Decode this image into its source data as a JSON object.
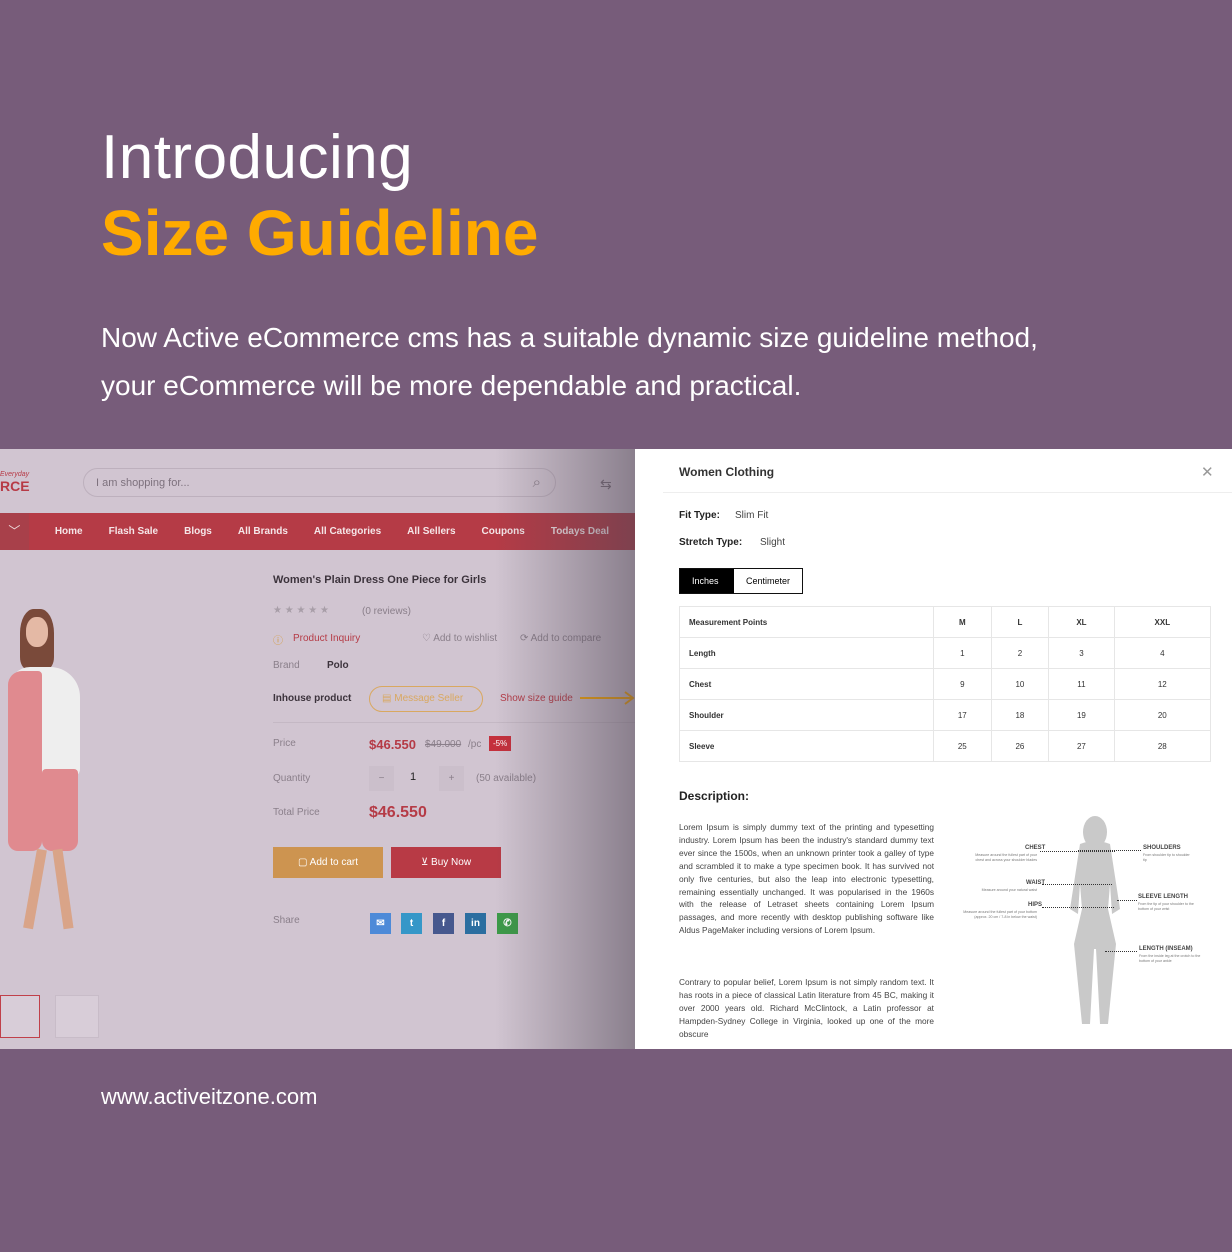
{
  "hero": {
    "intro": "Introducing",
    "headline": "Size Guideline",
    "lead": "Now Active eCommerce cms has a suitable dynamic size guideline method, your eCommerce will be more dependable and practical.",
    "website": "www.activeitzone.com",
    "accent": "#ffab00",
    "background": "#775c7a"
  },
  "shop": {
    "logo": {
      "script": "Everyday",
      "text": "RCE"
    },
    "search_placeholder": "I am shopping for...",
    "nav": [
      "Home",
      "Flash Sale",
      "Blogs",
      "All Brands",
      "All Categories",
      "All Sellers",
      "Coupons",
      "Todays Deal"
    ],
    "product": {
      "title": "Women's Plain Dress One Piece for Girls",
      "rating": 0,
      "reviews": "(0 reviews)",
      "inquiry": "Product Inquiry",
      "wishlist": "Add to wishlist",
      "compare": "Add to compare",
      "brand_label": "Brand",
      "brand": "Polo",
      "seller": "Inhouse product",
      "message_seller": "Message Seller",
      "size_guide": "Show size guide",
      "price_label": "Price",
      "price": "$46.550",
      "old_price": "$49.000",
      "unit": "/pc",
      "discount": "-5%",
      "qty_label": "Quantity",
      "qty": "1",
      "available": "(50 available)",
      "total_label": "Total Price",
      "total": "$46.550",
      "add_to_cart": "Add to cart",
      "buy_now": "Buy Now",
      "share_label": "Share"
    },
    "brand_color": "#b53b46"
  },
  "modal": {
    "title": "Women Clothing",
    "fit_label": "Fit Type:",
    "fit": "Slim Fit",
    "stretch_label": "Stretch Type:",
    "stretch": "Slight",
    "units": [
      "Inches",
      "Centimeter"
    ],
    "active_unit": "Inches",
    "table": {
      "headers": [
        "Measurement Points",
        "M",
        "L",
        "XL",
        "XXL"
      ],
      "rows": [
        [
          "Length",
          "1",
          "2",
          "3",
          "4"
        ],
        [
          "Chest",
          "9",
          "10",
          "11",
          "12"
        ],
        [
          "Shoulder",
          "17",
          "18",
          "19",
          "20"
        ],
        [
          "Sleeve",
          "25",
          "26",
          "27",
          "28"
        ]
      ]
    },
    "description_title": "Description:",
    "description": [
      "Lorem Ipsum is simply dummy text of the printing and typesetting industry. Lorem Ipsum has been the industry's standard dummy text ever since the 1500s, when an unknown printer took a galley of type and scrambled it to make a type specimen book. It has survived not only five centuries, but also the leap into electronic typesetting, remaining essentially unchanged. It was popularised in the 1960s with the release of Letraset sheets containing Lorem Ipsum passages, and more recently with desktop publishing software like Aldus PageMaker including versions of Lorem Ipsum.",
      "Contrary to popular belief, Lorem Ipsum is not simply random text. It has roots in a piece of classical Latin literature from 45 BC, making it over 2000 years old. Richard McClintock, a Latin professor at Hampden-Sydney College in Virginia, looked up one of the more obscure"
    ],
    "diagram": {
      "chest": {
        "label": "CHEST",
        "sub": "Measure around the fullest part of your chest and across your shoulder blades"
      },
      "waist": {
        "label": "WAIST",
        "sub": "Measure around your natural waist"
      },
      "hips": {
        "label": "HIPS",
        "sub": "Measure around the fullest part of your bottom (approx. 20 cm / 7-8 in below the waist)"
      },
      "shoulders": {
        "label": "SHOULDERS",
        "sub": "From shoulder tip to shoulder tip"
      },
      "sleeve": {
        "label": "SLEEVE LENGTH",
        "sub": "From the tip of your shoulder to the bottom of your wrist"
      },
      "length": {
        "label": "LENGTH (INSEAM)",
        "sub": "From the inside leg at the crotch to the bottom of your ankle"
      }
    }
  }
}
